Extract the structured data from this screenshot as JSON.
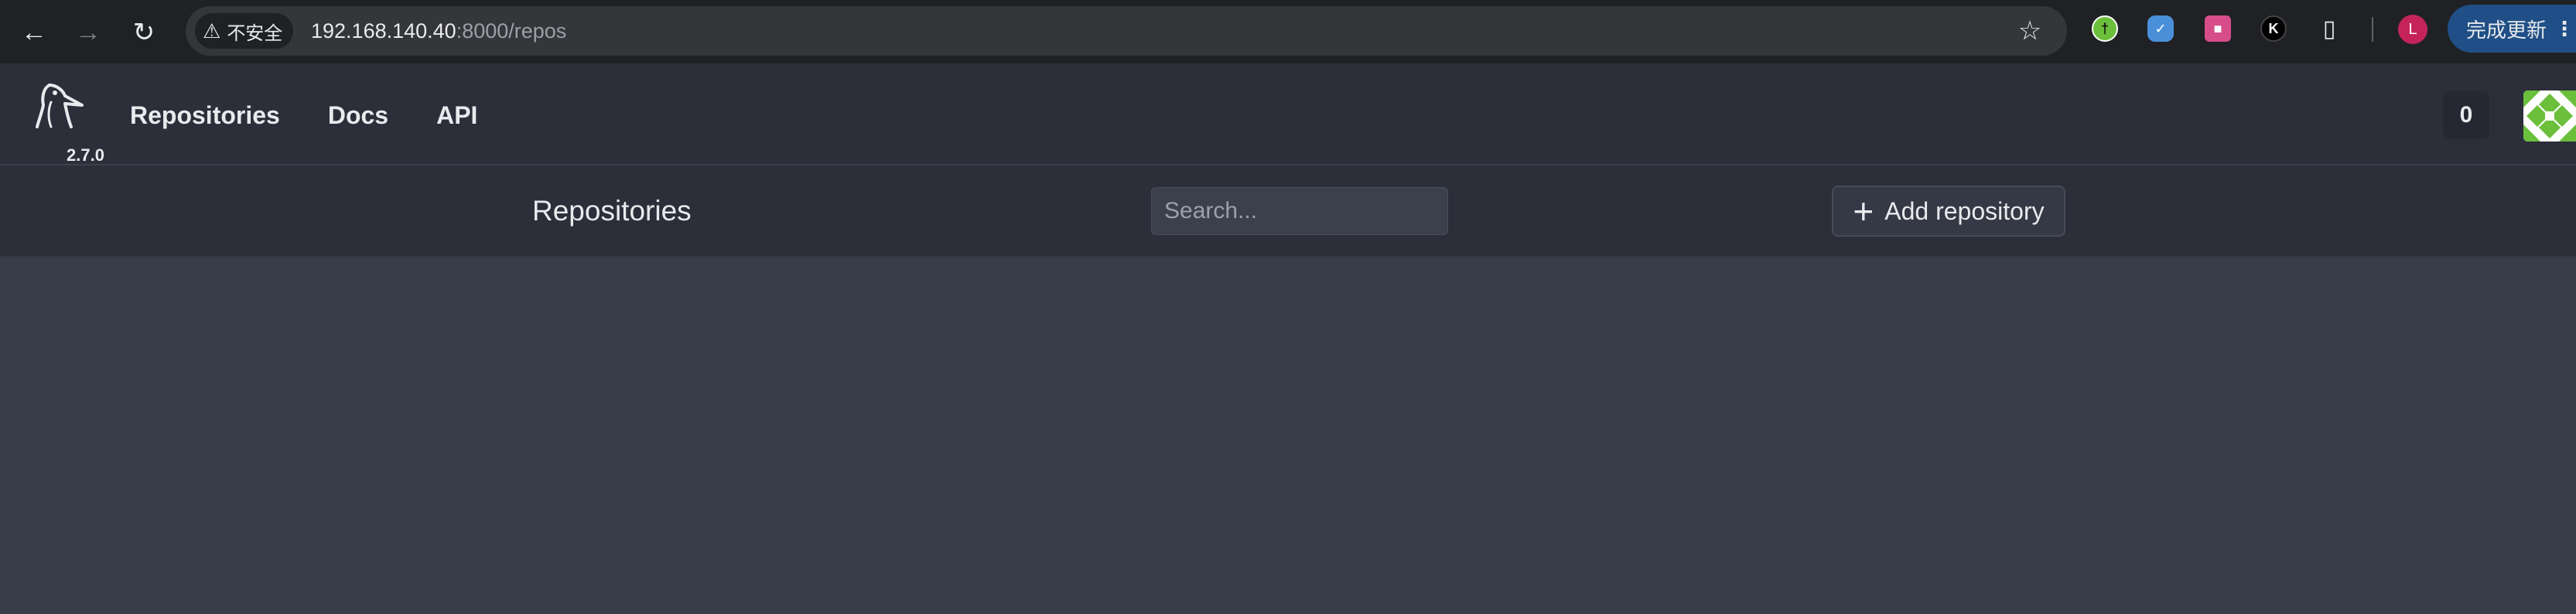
{
  "browser": {
    "security_label": "不安全",
    "url_host": "192.168.140.40",
    "url_rest": ":8000/repos",
    "profile_initial": "L",
    "update_label": "完成更新",
    "icons": {
      "back": "arrow-left-icon",
      "forward": "arrow-right-icon",
      "reload": "reload-icon",
      "warning": "warning-triangle-icon",
      "bookmark": "star-icon",
      "extensions": "puzzle-icon",
      "menu": "more-vertical-icon"
    }
  },
  "app": {
    "version": "2.7.0",
    "nav": {
      "repositories": "Repositories",
      "docs": "Docs",
      "api": "API"
    },
    "notifications_count": "0"
  },
  "page": {
    "title": "Repositories",
    "search_placeholder": "Search...",
    "add_button_label": "Add repository"
  },
  "colors": {
    "header_bg": "#2c2f3a",
    "content_bg": "#393d4a",
    "avatar_green": "#6bbf3b"
  }
}
